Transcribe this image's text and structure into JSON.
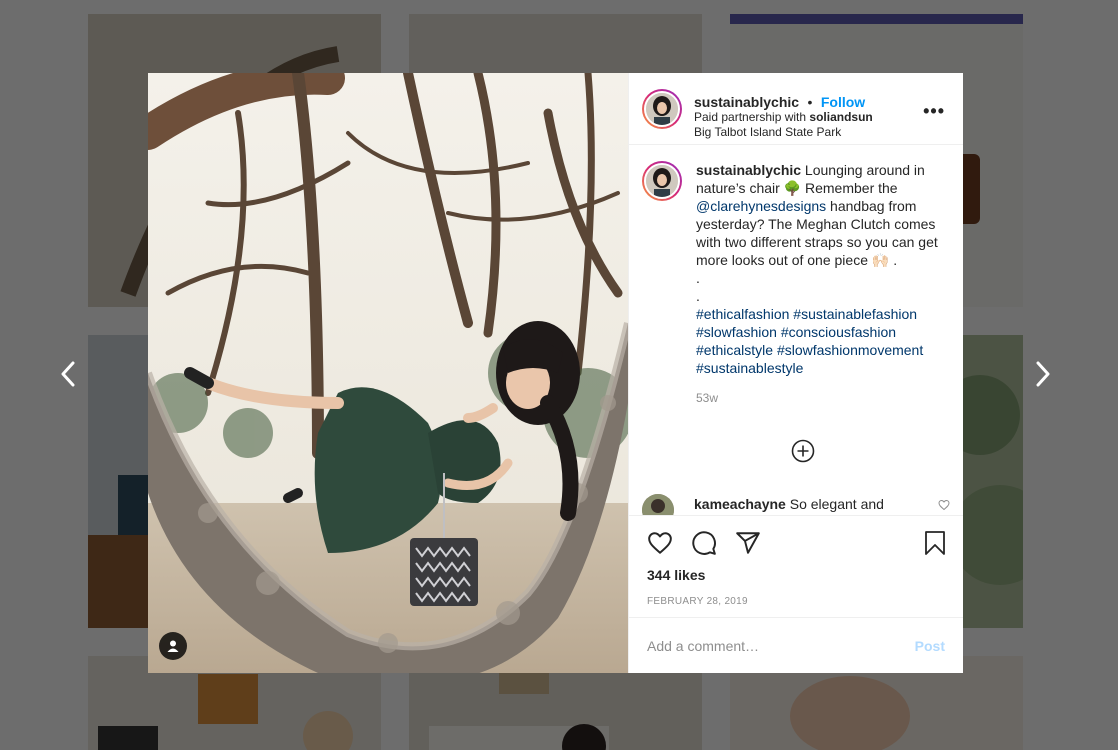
{
  "post": {
    "username": "sustainablychic",
    "follow_label": "Follow",
    "separator": "•",
    "partnership_prefix": "Paid partnership with",
    "partner": "soliandsun",
    "location": "Big Talbot Island State Park",
    "more_label": "•••"
  },
  "caption": {
    "username": "sustainablychic",
    "text_1": " Lounging around in nature’s chair 🌳 Remember the ",
    "mention": "@clarehynesdesigns",
    "text_2": " handbag from yesterday? The Meghan Clutch comes with two different straps so you can get more looks out of one piece 🙌🏻 .",
    "dot_1": ".",
    "dot_2": ".",
    "hashtags": [
      "#ethicalfashion",
      "#sustainablefashion",
      "#slowfashion",
      "#consciousfashion",
      "#ethicalstyle",
      "#slowfashionmovement",
      "#sustainablestyle"
    ],
    "time": "53w"
  },
  "comment": {
    "username": "kameachayne",
    "text": " So elegant and"
  },
  "actions": {
    "likes": "344 likes",
    "date": "FEBRUARY 28, 2019"
  },
  "add_comment": {
    "placeholder": "Add a comment…",
    "post_label": "Post"
  },
  "colors": {
    "accent": "#0095f6",
    "link": "#00376b",
    "muted": "#8e8e8e",
    "post_disabled": "#b3dbff"
  },
  "icons": [
    "chevron-left-icon",
    "chevron-right-icon",
    "more-icon",
    "add-circle-icon",
    "heart-icon",
    "comment-icon",
    "share-icon",
    "bookmark-icon",
    "user-tag-icon"
  ]
}
